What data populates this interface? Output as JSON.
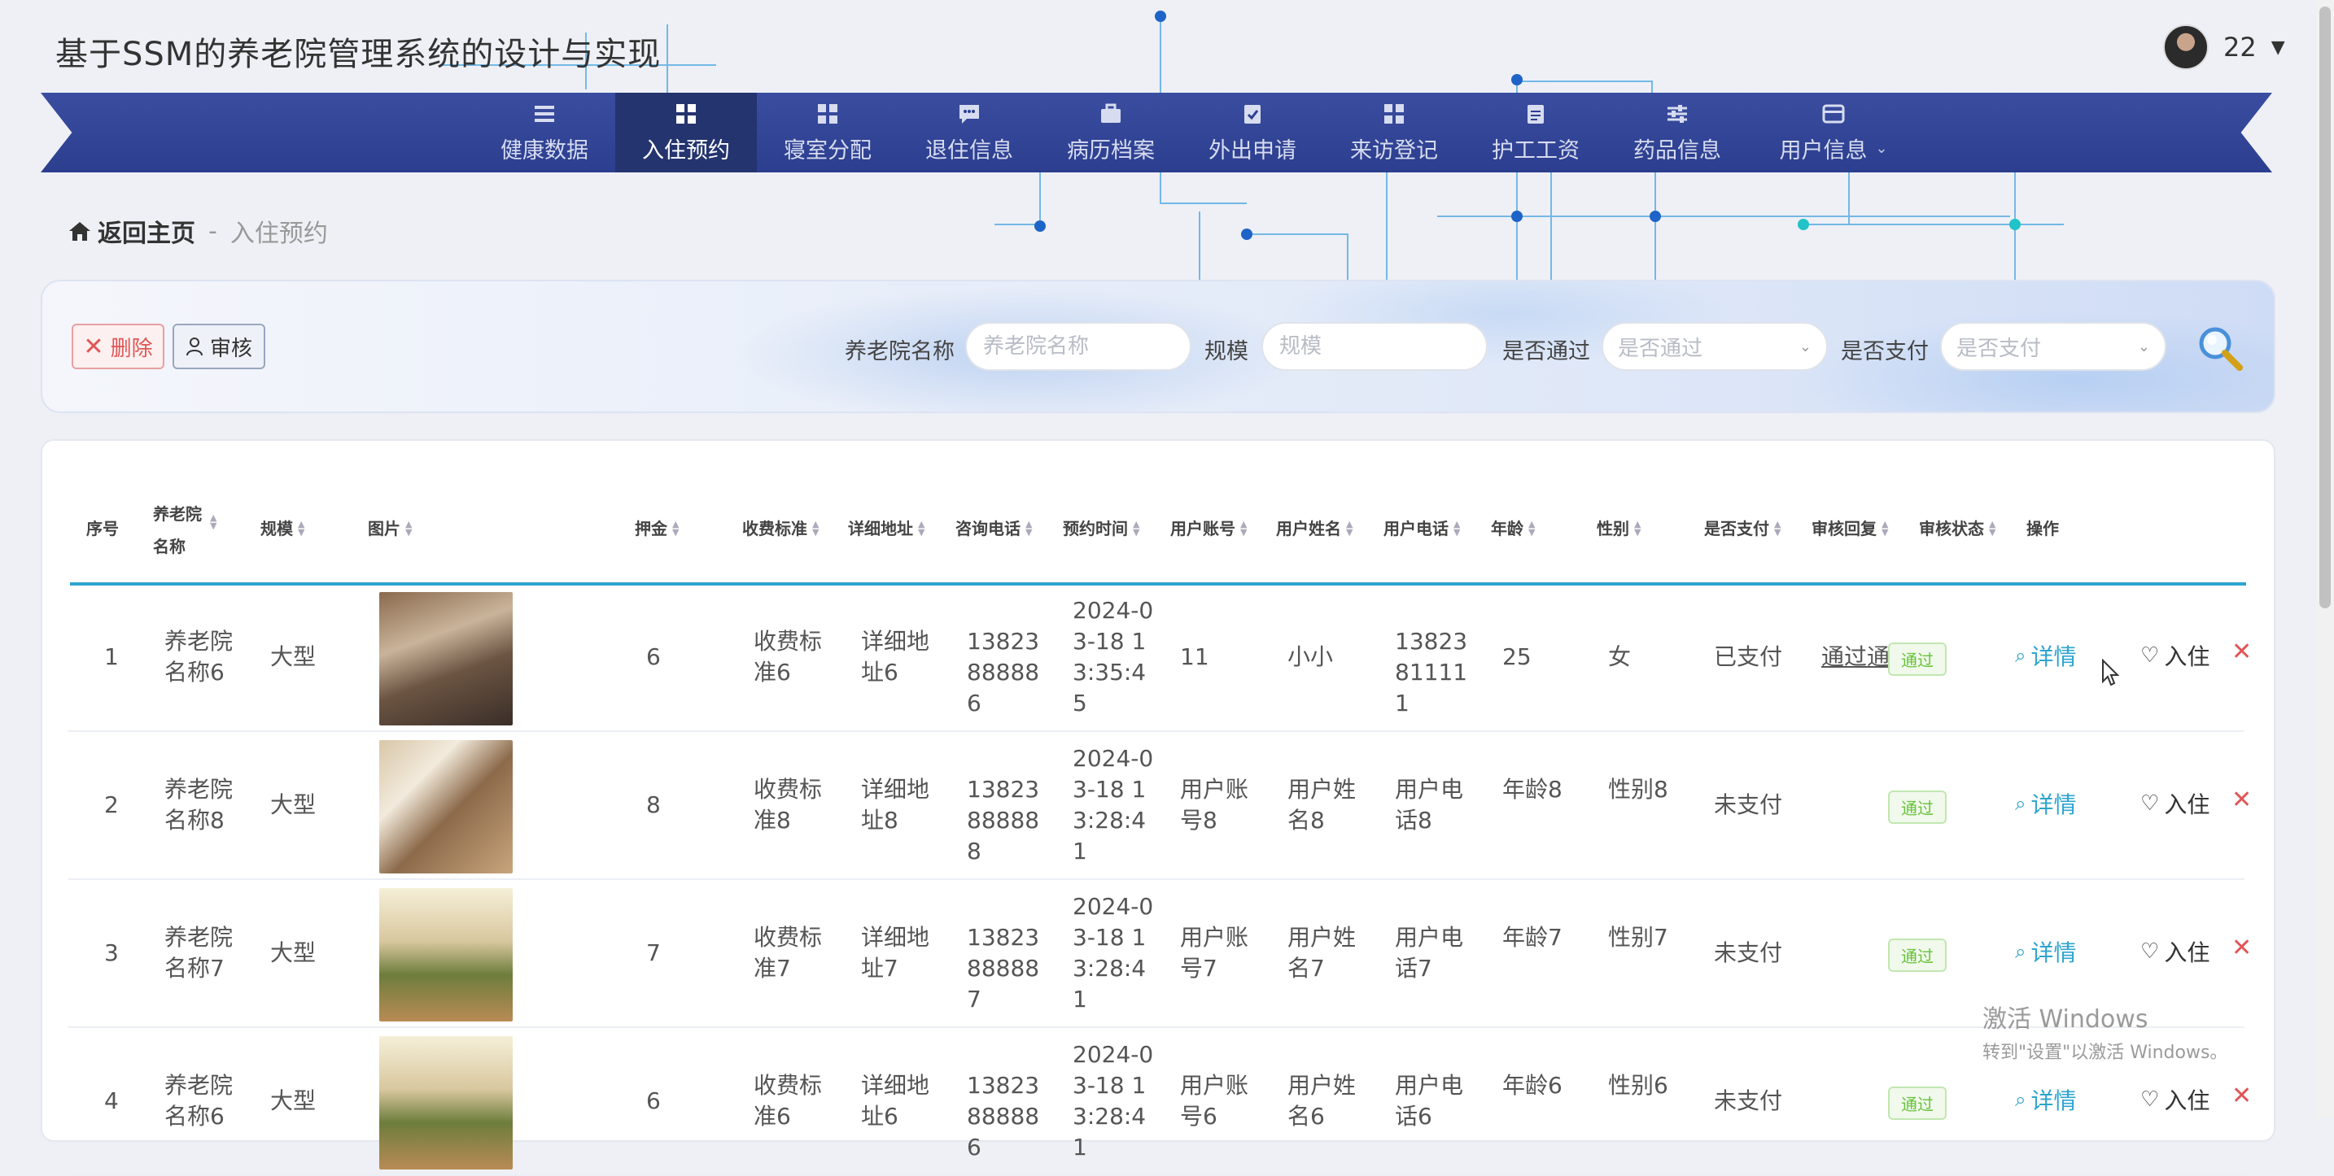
{
  "title": "基于SSM的养老院管理系统的设计与实现",
  "user": {
    "name": "22"
  },
  "nav": [
    {
      "label": "健康数据",
      "icon": "list-icon"
    },
    {
      "label": "入住预约",
      "icon": "grid-icon",
      "active": true
    },
    {
      "label": "寝室分配",
      "icon": "grid-icon"
    },
    {
      "label": "退住信息",
      "icon": "message-icon"
    },
    {
      "label": "病历档案",
      "icon": "briefcase-icon"
    },
    {
      "label": "外出申请",
      "icon": "clipboard-check-icon"
    },
    {
      "label": "来访登记",
      "icon": "grid-icon"
    },
    {
      "label": "护工工资",
      "icon": "clipboard-icon"
    },
    {
      "label": "药品信息",
      "icon": "sliders-icon"
    },
    {
      "label": "用户信息",
      "icon": "card-icon",
      "has_submenu": true
    }
  ],
  "breadcrumb": {
    "home": "返回主页",
    "separator": "-",
    "current": "入住预约"
  },
  "toolbar": {
    "delete_label": "删除",
    "audit_label": "审核"
  },
  "filters": {
    "name_label": "养老院名称",
    "name_placeholder": "养老院名称",
    "scale_label": "规模",
    "scale_placeholder": "规模",
    "passed_label": "是否通过",
    "passed_placeholder": "是否通过",
    "paid_label": "是否支付",
    "paid_placeholder": "是否支付"
  },
  "table": {
    "headers": {
      "index": "序号",
      "name": "养老院名称",
      "scale": "规模",
      "image": "图片",
      "deposit": "押金",
      "fee": "收费标准",
      "address": "详细地址",
      "phone": "咨询电话",
      "time": "预约时间",
      "account": "用户账号",
      "uname": "用户姓名",
      "uphone": "用户电话",
      "age": "年龄",
      "gender": "性别",
      "paid": "是否支付",
      "reply": "审核回复",
      "status": "审核状态",
      "ops": "操作"
    },
    "rows": [
      {
        "index": "1",
        "name": "养老院名称6",
        "scale": "大型",
        "deposit": "6",
        "fee": "收费标准6",
        "address": "详细地址6",
        "phone": "13823888886",
        "time": "2024-03-18 13:35:45",
        "account": "11",
        "uname": "小小",
        "uphone": "13823811111",
        "age": "25",
        "gender": "女",
        "paid": "已支付",
        "reply": "通过通过",
        "status": "通过"
      },
      {
        "index": "2",
        "name": "养老院名称8",
        "scale": "大型",
        "deposit": "8",
        "fee": "收费标准8",
        "address": "详细地址8",
        "phone": "13823888888",
        "time": "2024-03-18 13:28:41",
        "account": "用户账号8",
        "uname": "用户姓名8",
        "uphone": "用户电话8",
        "age": "年龄8",
        "gender": "性别8",
        "paid": "未支付",
        "reply": "",
        "status": "通过"
      },
      {
        "index": "3",
        "name": "养老院名称7",
        "scale": "大型",
        "deposit": "7",
        "fee": "收费标准7",
        "address": "详细地址7",
        "phone": "13823888887",
        "time": "2024-03-18 13:28:41",
        "account": "用户账号7",
        "uname": "用户姓名7",
        "uphone": "用户电话7",
        "age": "年龄7",
        "gender": "性别7",
        "paid": "未支付",
        "reply": "",
        "status": "通过"
      },
      {
        "index": "4",
        "name": "养老院名称6",
        "scale": "大型",
        "deposit": "6",
        "fee": "收费标准6",
        "address": "详细地址6",
        "phone": "13823888886",
        "time": "2024-03-18 13:28:41",
        "account": "用户账号6",
        "uname": "用户姓名6",
        "uphone": "用户电话6",
        "age": "年龄6",
        "gender": "性别6",
        "paid": "未支付",
        "reply": "",
        "status": "通过"
      }
    ],
    "actions": {
      "detail": "详情",
      "checkin": "入住"
    }
  },
  "watermark": {
    "line1": "激活 Windows",
    "line2": "转到\"设置\"以激活 Windows。"
  },
  "colors": {
    "nav": "#2c3e8e",
    "nav_active": "#24346f",
    "accent": "#2ea4cf",
    "danger": "#e05656",
    "success": "#67c23a"
  }
}
